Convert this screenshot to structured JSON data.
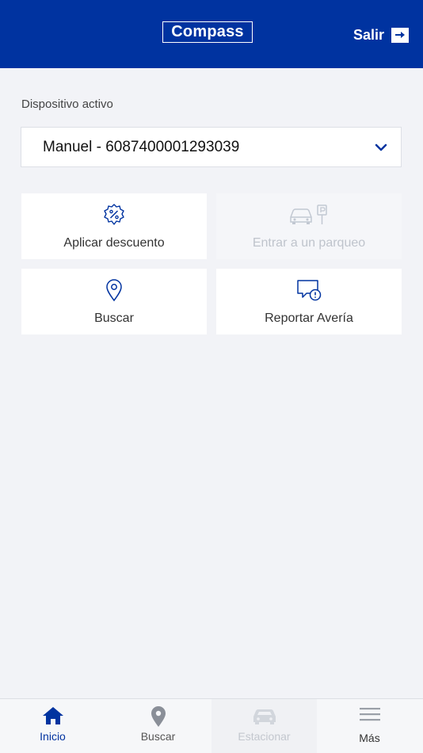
{
  "header": {
    "logo_text": "Compass",
    "logout_label": "Salir",
    "logout_icon": "arrow-right-box-icon",
    "color": "#0033a0"
  },
  "device": {
    "label": "Dispositivo activo",
    "selected": "Manuel - 6087400001293039"
  },
  "actions": [
    {
      "label": "Aplicar descuento",
      "icon": "discount-badge-icon",
      "enabled": true
    },
    {
      "label": "Entrar a un parqueo",
      "icon": "car-parking-icon",
      "enabled": false
    },
    {
      "label": "Buscar",
      "icon": "map-pin-icon",
      "enabled": true
    },
    {
      "label": "Reportar Avería",
      "icon": "report-alert-icon",
      "enabled": true
    }
  ],
  "tabs": [
    {
      "label": "Inicio",
      "icon": "home-icon",
      "active": true
    },
    {
      "label": "Buscar",
      "icon": "map-pin-icon",
      "active": false
    },
    {
      "label": "Estacionar",
      "icon": "car-icon",
      "active": false,
      "disabled": true
    },
    {
      "label": "Más",
      "icon": "menu-icon",
      "active": false
    }
  ]
}
